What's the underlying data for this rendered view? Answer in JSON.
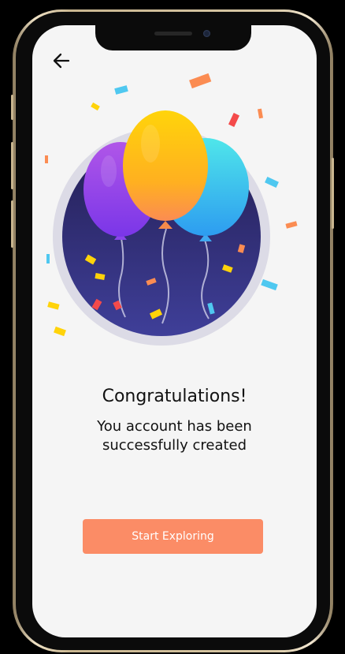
{
  "header": {
    "back_icon": "arrow-left-icon"
  },
  "illustration": {
    "icon": "balloons-celebration-icon"
  },
  "content": {
    "title": "Congratulations!",
    "message_line1": "You account has been",
    "message_line2": "successfully created"
  },
  "actions": {
    "primary_label": "Start Exploring"
  },
  "colors": {
    "background": "#f5f5f5",
    "accent": "#fb8c66",
    "text": "#111111",
    "circle": "#2b2766"
  }
}
